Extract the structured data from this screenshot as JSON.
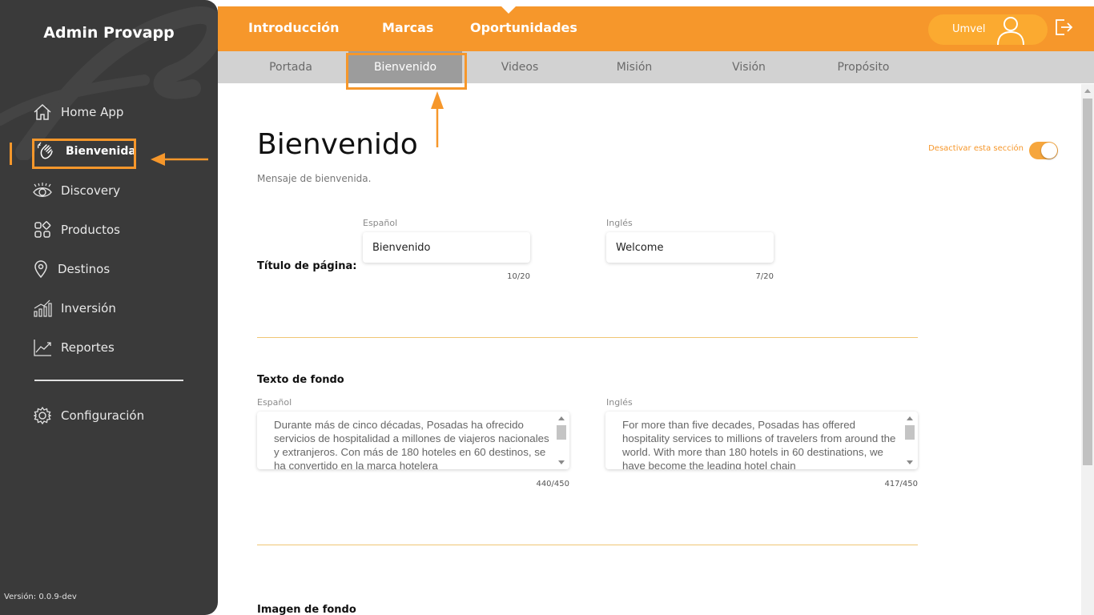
{
  "sidebar": {
    "brand": "Admin Provapp",
    "items": [
      {
        "label": "Home App",
        "icon": "home-icon"
      },
      {
        "label": "Bienvenida",
        "icon": "waving-hand-icon"
      },
      {
        "label": "Discovery",
        "icon": "eye-icon"
      },
      {
        "label": "Productos",
        "icon": "grid-icon"
      },
      {
        "label": "Destinos",
        "icon": "map-pin-icon"
      },
      {
        "label": "Inversión",
        "icon": "bar-chart-icon"
      },
      {
        "label": "Reportes",
        "icon": "line-chart-icon"
      }
    ],
    "settings_label": "Configuración",
    "version": "Versión: 0.0.9-dev",
    "active_item": "Bienvenida"
  },
  "topnav": {
    "items": [
      "Introducción",
      "Marcas",
      "Oportunidades"
    ],
    "active": "Introducción",
    "user_name": "Umvel"
  },
  "subtabs": {
    "items": [
      "Portada",
      "Bienvenido",
      "Videos",
      "Misión",
      "Visión",
      "Propósito"
    ],
    "active": "Bienvenido"
  },
  "main": {
    "title": "Bienvenido",
    "subtitle": "Mensaje de bienvenida.",
    "toggle_label": "Desactivar esta sección",
    "toggle_on": true,
    "page_title_section": {
      "label": "Título de página:",
      "es_label": "Español",
      "en_label": "Inglés",
      "es_value": "Bienvenido",
      "en_value": "Welcome",
      "es_count": "10/20",
      "en_count": "7/20"
    },
    "background_text_section": {
      "label": "Texto de fondo",
      "es_label": "Español",
      "en_label": "Inglés",
      "es_value": "Durante más de cinco décadas, Posadas ha ofrecido servicios de hospitalidad a millones de viajeros nacionales y extranjeros. Con más de 180 hoteles en 60 destinos, se ha convertido en la marca hotelera",
      "en_value": "For more than five decades, Posadas has offered hospitality services to millions of travelers from around the world. With more than 180 hotels in 60 destinations, we have become the leading hotel chain",
      "es_count": "440/450",
      "en_count": "417/450"
    },
    "background_image_section": {
      "label": "Imagen de fondo"
    }
  },
  "colors": {
    "accent": "#f6972b",
    "sidebar_bg": "#3a3a3a",
    "subbar_bg": "#d2d2d2",
    "active_tab_bg": "#9c9c9c"
  }
}
